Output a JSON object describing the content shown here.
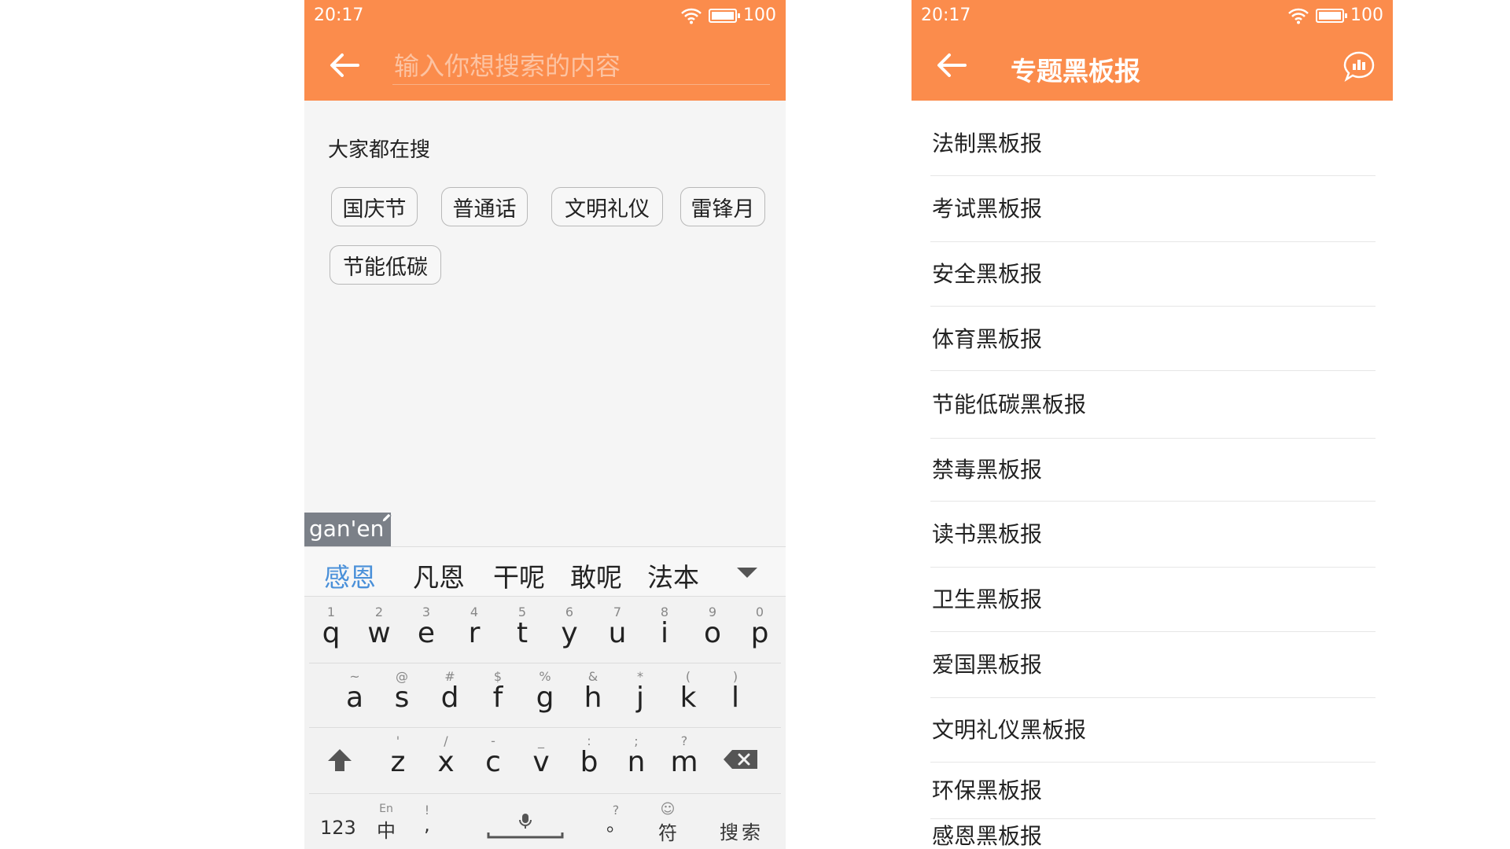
{
  "status": {
    "time": "20:17",
    "battery": "100"
  },
  "search": {
    "placeholder": "输入你想搜索的内容",
    "hot_title": "大家都在搜",
    "tags": [
      "国庆节",
      "普通话",
      "文明礼仪",
      "雷锋月",
      "节能低碳"
    ]
  },
  "keyboard": {
    "composition": "gan'en",
    "candidates": [
      "感恩",
      "凡恩",
      "干呢",
      "敢呢",
      "法本"
    ],
    "row1": [
      {
        "sub": "1",
        "key": "q"
      },
      {
        "sub": "2",
        "key": "w"
      },
      {
        "sub": "3",
        "key": "e"
      },
      {
        "sub": "4",
        "key": "r"
      },
      {
        "sub": "5",
        "key": "t"
      },
      {
        "sub": "6",
        "key": "y"
      },
      {
        "sub": "7",
        "key": "u"
      },
      {
        "sub": "8",
        "key": "i"
      },
      {
        "sub": "9",
        "key": "o"
      },
      {
        "sub": "0",
        "key": "p"
      }
    ],
    "row2": [
      {
        "sub": "~",
        "key": "a"
      },
      {
        "sub": "@",
        "key": "s"
      },
      {
        "sub": "#",
        "key": "d"
      },
      {
        "sub": "$",
        "key": "f"
      },
      {
        "sub": "%",
        "key": "g"
      },
      {
        "sub": "&",
        "key": "h"
      },
      {
        "sub": "*",
        "key": "j"
      },
      {
        "sub": "(",
        "key": "k"
      },
      {
        "sub": ")",
        "key": "l"
      }
    ],
    "row3": [
      {
        "sub": "'",
        "key": "z"
      },
      {
        "sub": "/",
        "key": "x"
      },
      {
        "sub": "-",
        "key": "c"
      },
      {
        "sub": "_",
        "key": "v"
      },
      {
        "sub": ":",
        "key": "b"
      },
      {
        "sub": ";",
        "key": "n"
      },
      {
        "sub": "?",
        "key": "m"
      }
    ],
    "num_label": "123",
    "lang_sub": "En",
    "lang_main": "中",
    "comma_sub": "!",
    "comma_main": ",",
    "period_sub": "?",
    "period_main": "。",
    "symbol_main": "符",
    "search_label": "搜索"
  },
  "topics": {
    "title": "专题黑板报",
    "items": [
      "法制黑板报",
      "考试黑板报",
      "安全黑板报",
      "体育黑板报",
      "节能低碳黑板报",
      "禁毒黑板报",
      "读书黑板报",
      "卫生黑板报",
      "爱国黑板报",
      "文明礼仪黑板报",
      "环保黑板报",
      "感恩黑板报"
    ]
  },
  "colors": {
    "accent": "#fb8c4c",
    "candidate_highlight": "#4a90d9"
  }
}
